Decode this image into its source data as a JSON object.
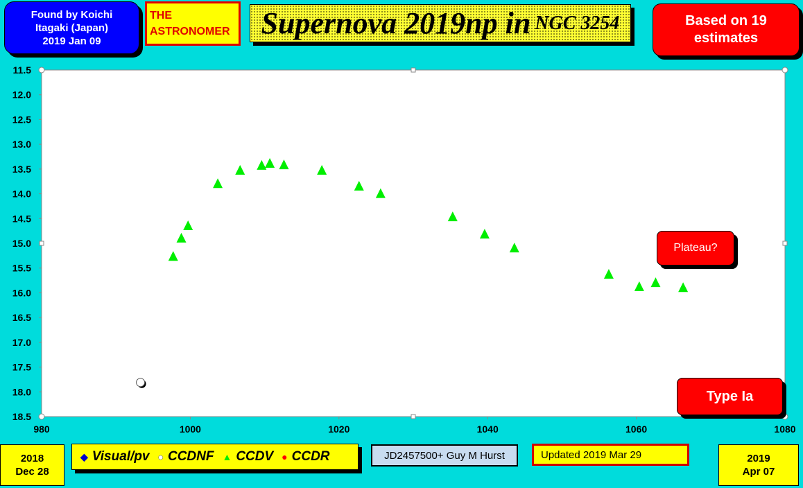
{
  "header": {
    "found": [
      "Found by Koichi",
      "Itagaki (Japan)",
      "2019 Jan 09"
    ],
    "publisher": [
      "THE",
      "ASTRONOMER"
    ],
    "title": "Supernova 2019np in",
    "title_small": "NGC 3254",
    "estimates": [
      "Based on 19",
      "estimates"
    ]
  },
  "annotations": {
    "plateau": "Plateau?",
    "type": "Type Ia"
  },
  "footer": {
    "start_date": [
      "2018",
      "Dec 28"
    ],
    "end_date": [
      "2019",
      "Apr 07"
    ],
    "jd_label": "JD2457500+ Guy M Hurst",
    "updated": "Updated 2019 Mar 29",
    "legend": [
      {
        "label": "Visual/pv",
        "symbol": "◆",
        "color": "#0000cc"
      },
      {
        "label": "CCDNF",
        "symbol": "●",
        "color": "#ffffff"
      },
      {
        "label": "CCDV",
        "symbol": "▲",
        "color": "#00ee00"
      },
      {
        "label": "CCDR",
        "symbol": "●",
        "color": "#ff0000"
      }
    ]
  },
  "chart_data": {
    "type": "scatter",
    "xlim": [
      980,
      1080
    ],
    "ylim": [
      18.5,
      11.5
    ],
    "y_inverted": true,
    "xticks": [
      980,
      1000,
      1020,
      1040,
      1060,
      1080
    ],
    "yticks": [
      11.5,
      12.0,
      12.5,
      13.0,
      13.5,
      14.0,
      14.5,
      15.0,
      15.5,
      16.0,
      16.5,
      17.0,
      17.5,
      18.0,
      18.5
    ],
    "grid": false,
    "series": [
      {
        "name": "CCDNF",
        "marker": "circle",
        "color": "#ffffff",
        "points": [
          [
            993.3,
            17.81
          ]
        ]
      },
      {
        "name": "CCDV",
        "marker": "triangle",
        "color": "#00ee00",
        "points": [
          [
            997.7,
            15.27
          ],
          [
            998.8,
            14.9
          ],
          [
            999.7,
            14.65
          ],
          [
            1003.7,
            13.8
          ],
          [
            1006.7,
            13.53
          ],
          [
            1009.6,
            13.43
          ],
          [
            1010.7,
            13.39
          ],
          [
            1012.6,
            13.42
          ],
          [
            1017.7,
            13.53
          ],
          [
            1022.7,
            13.85
          ],
          [
            1025.6,
            14.0
          ],
          [
            1035.3,
            14.47
          ],
          [
            1039.6,
            14.82
          ],
          [
            1043.6,
            15.1
          ],
          [
            1056.3,
            15.63
          ],
          [
            1060.4,
            15.88
          ],
          [
            1062.6,
            15.8
          ],
          [
            1066.3,
            15.9
          ]
        ]
      }
    ]
  }
}
